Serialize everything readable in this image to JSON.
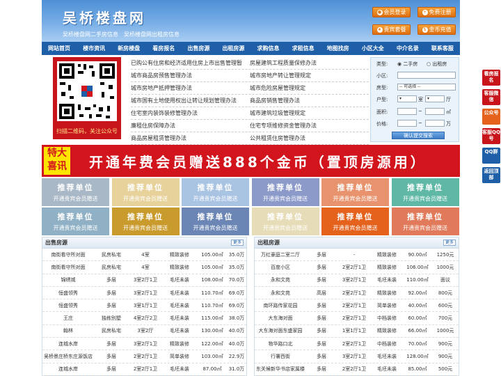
{
  "site": {
    "title": "吴桥楼盘网",
    "slogan": "吴桥楼盘网二手房信息　吴桥楼盘网出租房信息"
  },
  "header_buttons": [
    {
      "label": "会员登录",
      "icon": "user-icon"
    },
    {
      "label": "免费注册",
      "icon": "register-icon"
    },
    {
      "label": "贵宾套餐",
      "icon": "vip-icon"
    },
    {
      "label": "金币充值",
      "icon": "coin-icon"
    }
  ],
  "nav": [
    "网站首页",
    "楼市资讯",
    "新房楼盘",
    "看房报名",
    "出售房源",
    "出租房源",
    "求购信息",
    "求租信息",
    "地图找房",
    "小区大全",
    "中介名录",
    "联系客服"
  ],
  "qr": {
    "caption": "扫描二维码，关注公众号"
  },
  "rules": [
    [
      "已购公有住房和经济适用住房上市出售管理暂",
      "房屋建筑工程质量保修办法"
    ],
    [
      "城市商品房预售管理办法",
      "城市房地产转让管理规定"
    ],
    [
      "城市房地产抵押管理办法",
      "城市危险房屋管理规定"
    ],
    [
      "城市国有土地使用权出让转让规划管理办法",
      "商品房销售管理办法"
    ],
    [
      "住宅室内装饰装修管理办法",
      "城市建筑垃圾管理规定"
    ],
    [
      "廉租住房保障办法",
      "住宅专项维修资金管理办法"
    ],
    [
      "商品房屋租赁管理办法",
      "公共租赁住房管理办法"
    ]
  ],
  "search": {
    "type_label": "类型:",
    "opt_sell": "二手房",
    "opt_rent": "出租房",
    "community_label": "小区:",
    "building_label": "房型:",
    "building_select": "-- 可选择 --",
    "layout_label": "户型:",
    "room_unit": "室",
    "hall_unit": "厅",
    "area_label": "面积:",
    "area_unit": "㎡",
    "price_label": "价格:",
    "price_unit": "万",
    "tilde": "~",
    "submit": "确认提交搜索"
  },
  "banner": {
    "tag_l1": "特大",
    "tag_l2": "喜讯",
    "text": "开通年费会员赠送888个金币（置顶房源用）"
  },
  "tiles": {
    "title": "推荐单位",
    "subtitle": "开通贵宾会员赠送",
    "colors": [
      "#a8b8c6",
      "#e6d29a",
      "#a9c3e3",
      "#8c9ac9",
      "#e8936e",
      "#5fb8a5",
      "#8fb0c5",
      "#c99a2c",
      "#6b86b5",
      "#e6ddb8",
      "#e5621c",
      "#e07a5a"
    ]
  },
  "sale": {
    "title": "出售房源",
    "more": "更多",
    "rows": [
      [
        "南街看守所对面",
        "民房私宅",
        "4室",
        "精致装修",
        "105.00㎡",
        "35.0万"
      ],
      [
        "南街看守所对面",
        "民房私宅",
        "4室",
        "精致装修",
        "105.00㎡",
        "35.0万"
      ],
      [
        "锦绣城",
        "多层",
        "3室2厅1卫",
        "毛坯未装",
        "108.00㎡",
        "70.0万"
      ],
      [
        "恒盛领秀",
        "多层",
        "3室2厅1卫",
        "毛坯未装",
        "110.70㎡",
        "69.0万"
      ],
      [
        "恒盛领秀",
        "多层",
        "3室1厅1卫",
        "毛坯未装",
        "110.70㎡",
        "69.0万"
      ],
      [
        "王庄",
        "独栋别墅",
        "4室2厅2卫",
        "毛坯未装",
        "115.00㎡",
        "38.0万"
      ],
      [
        "翰林",
        "民房私宅",
        "3室2厅",
        "毛坯未装",
        "130.00㎡",
        "40.0万"
      ],
      [
        "连城水岸",
        "多层",
        "3室2厅1卫",
        "精致装修",
        "122.00㎡",
        "40.0万"
      ],
      [
        "吴桥景庄桥东庄源饭店",
        "多层",
        "2室2厅1卫",
        "简单装修",
        "103.00㎡",
        "22.9万"
      ],
      [
        "连城水岸",
        "多层",
        "2室2厅1卫",
        "毛坯未装",
        "87.00㎡",
        "31.0万"
      ]
    ]
  },
  "rent": {
    "title": "出租房源",
    "more": "更多",
    "rows": [
      [
        "万红豪庭二室二厅",
        "多层",
        "-",
        "精致装修",
        "90.00㎡",
        "1250元"
      ],
      [
        "百度小区",
        "多层",
        "2室2厅1卫",
        "精致装修",
        "106.00㎡",
        "1000元"
      ],
      [
        "永和文苑",
        "多层",
        "3室2厅1卫",
        "毛坯未装",
        "110.00㎡",
        "面议"
      ],
      [
        "永和文苑",
        "高层",
        "2室2厅1卫",
        "精致装修",
        "92.00㎡",
        "800元"
      ],
      [
        "南环路传家花园",
        "多层",
        "2室2厅1卫",
        "简单装修",
        "40.00㎡",
        "600元"
      ],
      [
        "大东海对面",
        "多层",
        "2室2厅1卫",
        "中档装修",
        "60.00㎡",
        "700元"
      ],
      [
        "大东海对面东盛家园",
        "多层",
        "1室1厅1卫",
        "精致装修",
        "66.00㎡",
        "1000元"
      ],
      [
        "物华路口北",
        "多层",
        "2室2厅1卫",
        "中档装修",
        "70.00㎡",
        "900元"
      ],
      [
        "行署西街",
        "多层",
        "3室2厅1卫",
        "毛坯未装",
        "128.00㎡",
        "900元"
      ],
      [
        "东关候新华书店家属楼",
        "多层",
        "2室2厅1卫",
        "毛坯未装",
        "85.00㎡",
        "500元"
      ]
    ]
  },
  "side": [
    {
      "label": "看房报名",
      "color": "red"
    },
    {
      "label": "客服微信",
      "color": "red"
    },
    {
      "label": "公众号",
      "color": "orange"
    },
    {
      "label": "客服QQ号",
      "color": "red"
    },
    {
      "label": "QQ群",
      "color": "blue"
    },
    {
      "label": "返回顶部",
      "color": "blue"
    }
  ]
}
